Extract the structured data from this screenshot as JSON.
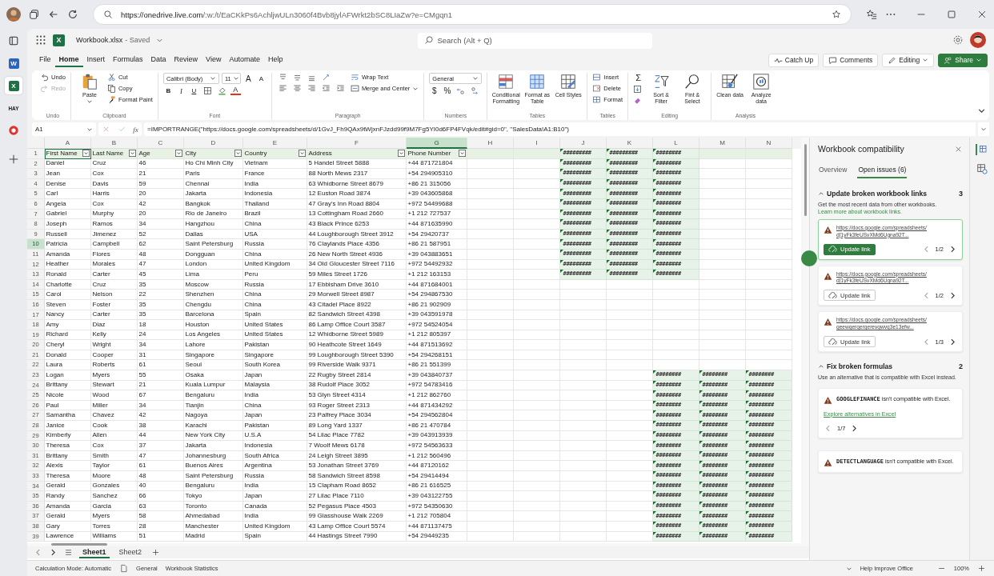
{
  "browser": {
    "url_host": "https://onedrive.live.com",
    "url_path": "/:w:/t/EaCKkPs6AchljwULn3060f4Bvb8jylAFWrkt2bSC8LIaZw?e=CMgqn1"
  },
  "edge_bar": [
    {
      "kind": "tabs",
      "selected": false
    },
    {
      "kind": "word",
      "letter": "W",
      "selected": false
    },
    {
      "kind": "excel",
      "letter": "X",
      "selected": true
    },
    {
      "kind": "text",
      "label": "HAY",
      "selected": false
    },
    {
      "kind": "red",
      "selected": false
    }
  ],
  "header": {
    "logo_letter": "X",
    "file": "Workbook.xlsx",
    "status": "- Saved",
    "search": {
      "placeholder": "Search (Alt + Q)"
    }
  },
  "menu": [
    {
      "label": "File",
      "selected": false
    },
    {
      "label": "Home",
      "selected": true
    },
    {
      "label": "Insert",
      "selected": false
    },
    {
      "label": "Formulas",
      "selected": false
    },
    {
      "label": "Data",
      "selected": false
    },
    {
      "label": "Review",
      "selected": false
    },
    {
      "label": "View",
      "selected": false
    },
    {
      "label": "Automate",
      "selected": false
    },
    {
      "label": "Help",
      "selected": false
    }
  ],
  "actions": {
    "catch_up": "Catch Up",
    "comments": "Comments",
    "editing": "Editing",
    "share": "Share"
  },
  "ribbon": {
    "undo": {
      "label": "Undo",
      "redo": "Redo",
      "redo_disabled": true,
      "group": "Undo"
    },
    "clipboard": {
      "paste": "Paste",
      "cut": "Cut",
      "copy": "Copy",
      "format_paint": "Format Paint",
      "group": "Clipboard"
    },
    "font": {
      "family": "Calibri (Body)",
      "size": "11",
      "grow": "A",
      "shrink": "A",
      "bold": "B",
      "italic": "I",
      "underline": "U",
      "font_color_glyph": "A",
      "group": "Font"
    },
    "paragraph": {
      "wrap": "Wrap Text",
      "merge": "Merge and Center",
      "group": "Paragraph"
    },
    "numbers": {
      "format": "General",
      "currency": "$",
      "percent": "%",
      "group": "Numbers"
    },
    "styles": {
      "conditional": "Conditional Formatting",
      "table": "Format as Table",
      "cell_styles": "Cell Styles",
      "group": "Tables"
    },
    "cells": {
      "insert": "Insert",
      "delete": "Delete",
      "format": "Format",
      "group": "Tables"
    },
    "editing": {
      "sum": "Σ",
      "sort": "Sort & Filter",
      "find": "Fint & Select",
      "group": "Editing"
    },
    "analysis": {
      "clean": "Clean data",
      "analyze": "Analyze data",
      "group": "Analysis"
    }
  },
  "formula_bar": {
    "name_box": "A1",
    "fx": "fx",
    "formula": "=IMPORTRANGE(\"https://docs.google.com/spreadsheets/d/1GvJ_Fh9QAx9tWjxnFJzdd99f9M7Fg5YI0d6FP4FVqk/edit#gid=0\", \"SalesData!A1:B10\")"
  },
  "sheet": {
    "columns": [
      {
        "label": "A",
        "selected": false
      },
      {
        "label": "B",
        "selected": false
      },
      {
        "label": "C",
        "selected": false
      },
      {
        "label": "D",
        "selected": false
      },
      {
        "label": "E",
        "selected": false
      },
      {
        "label": "F",
        "selected": false
      },
      {
        "label": "G",
        "selected": true
      },
      {
        "label": "H",
        "selected": false
      },
      {
        "label": "I",
        "selected": false
      },
      {
        "label": "J",
        "selected": false
      },
      {
        "label": "K",
        "selected": false
      },
      {
        "label": "L",
        "selected": false
      },
      {
        "label": "M",
        "selected": false
      },
      {
        "label": "N",
        "selected": false
      }
    ],
    "rows": [
      {
        "num": "1",
        "kind": "header",
        "selected": false,
        "cells": [
          "First Name",
          "Last Name",
          "Age",
          "City",
          "Country",
          "Address",
          "Phone Number"
        ],
        "overflow": {
          "kind": "upper",
          "values": [
            "#########",
            "#########",
            "########"
          ]
        }
      },
      {
        "num": "2",
        "kind": "data",
        "selected": false,
        "cells": [
          "Daniel",
          "Cruz",
          "46",
          "Ho Chi Minh City",
          "Vietnam",
          "5 Handel Street 5888",
          "+44 871721804"
        ],
        "overflow": {
          "kind": "upper",
          "values": [
            "#########",
            "#########",
            "########"
          ]
        }
      },
      {
        "num": "3",
        "kind": "data",
        "selected": false,
        "cells": [
          "Jean",
          "Cox",
          "21",
          "Paris",
          "France",
          "88 North Mews 2317",
          "+54 294905310"
        ],
        "overflow": {
          "kind": "upper",
          "values": [
            "#########",
            "#########",
            "########"
          ]
        }
      },
      {
        "num": "4",
        "kind": "data",
        "selected": false,
        "cells": [
          "Denise",
          "Davis",
          "59",
          "Chennai",
          "India",
          "63 Whidborne Street 8679",
          "+86 21 315056"
        ],
        "overflow": {
          "kind": "upper",
          "values": [
            "#########",
            "#########",
            "########"
          ]
        }
      },
      {
        "num": "5",
        "kind": "data",
        "selected": false,
        "cells": [
          "Carl",
          "Harris",
          "20",
          "Jakarta",
          "Indonesia",
          "12 Euston Road 3874",
          "+39 043605868"
        ],
        "overflow": {
          "kind": "upper",
          "values": [
            "#########",
            "#########",
            "########"
          ]
        }
      },
      {
        "num": "6",
        "kind": "data",
        "selected": false,
        "cells": [
          "Angela",
          "Cox",
          "42",
          "Bangkok",
          "Thailand",
          "47 Gray's Inn Road 8804",
          "+972 54499688"
        ],
        "overflow": {
          "kind": "upper",
          "values": [
            "#########",
            "#########",
            "########"
          ]
        }
      },
      {
        "num": "7",
        "kind": "data",
        "selected": false,
        "cells": [
          "Gabriel",
          "Murphy",
          "20",
          "Rio de  Janeiro",
          "Brazil",
          "13 Cottingham Road 2660",
          "+1 212 727537"
        ],
        "overflow": {
          "kind": "upper",
          "values": [
            "#########",
            "#########",
            "########"
          ]
        }
      },
      {
        "num": "8",
        "kind": "data",
        "selected": false,
        "cells": [
          "Joseph",
          "Ramos",
          "34",
          "Hangzhou",
          "China",
          "43 Black Prince 6253",
          "+44 871635990"
        ],
        "overflow": {
          "kind": "upper",
          "values": [
            "#########",
            "#########",
            "########"
          ]
        }
      },
      {
        "num": "9",
        "kind": "data",
        "selected": false,
        "cells": [
          "Russell",
          "Jimenez",
          "52",
          "Dallas",
          "USA",
          "44 Loughborough Street 3912",
          "+54 29420737"
        ],
        "overflow": {
          "kind": "upper",
          "values": [
            "#########",
            "#########",
            "########"
          ]
        }
      },
      {
        "num": "10",
        "kind": "data",
        "selected": true,
        "cells": [
          "Patricia",
          "Campbell",
          "62",
          "Saint Petersburg",
          "Russia",
          "76 Claylands Place 4356",
          "+86 21 587951"
        ],
        "overflow": {
          "kind": "upper",
          "values": [
            "#########",
            "#########",
            "########"
          ]
        }
      },
      {
        "num": "11",
        "kind": "data",
        "selected": false,
        "cells": [
          "Amanda",
          "Flores",
          "48",
          "Dongguan",
          "China",
          "26 New North Street 4936",
          "+39 043883651"
        ],
        "overflow": {
          "kind": "upper",
          "values": [
            "#########",
            "#########",
            "########"
          ]
        }
      },
      {
        "num": "12",
        "kind": "data",
        "selected": false,
        "cells": [
          "Heather",
          "Morales",
          "47",
          "London",
          "United Kingdom",
          "34 Old Gloucester Street 7116",
          "+972 54492932"
        ],
        "overflow": {
          "kind": "upper",
          "values": [
            "#########",
            "#########",
            "########"
          ]
        }
      },
      {
        "num": "13",
        "kind": "data",
        "selected": false,
        "cells": [
          "Ronald",
          "Carter",
          "45",
          "Lima",
          "Peru",
          "59 Miles Street 1726",
          "+1 212 163153"
        ],
        "overflow": {
          "kind": "upper",
          "values": [
            "#########",
            "#########",
            "########"
          ]
        }
      },
      {
        "num": "14",
        "kind": "data",
        "selected": false,
        "cells": [
          "Charlotte",
          "Cruz",
          "35",
          "Moscow",
          "Russia",
          "17 Ebbisham Drive 3610",
          "+44 871684001"
        ]
      },
      {
        "num": "15",
        "kind": "data",
        "selected": false,
        "cells": [
          "Carol",
          "Nelson",
          "22",
          "Shenzhen",
          "China",
          "29 Morwell Street 8987",
          "+54 294867530"
        ]
      },
      {
        "num": "16",
        "kind": "data",
        "selected": false,
        "cells": [
          "Steven",
          "Foster",
          "35",
          "Chengdu",
          "China",
          "43 Citadel Place 8922",
          "+86 21 902909"
        ]
      },
      {
        "num": "17",
        "kind": "data",
        "selected": false,
        "cells": [
          "Nancy",
          "Carter",
          "35",
          "Barcelona",
          "Spain",
          "82 Sandwich Street 4398",
          "+39 043591978"
        ]
      },
      {
        "num": "18",
        "kind": "data",
        "selected": false,
        "cells": [
          "Amy",
          "Diaz",
          "18",
          "Houston",
          "United States",
          "86 Lamp Office Court 3587",
          "+972 54524054"
        ]
      },
      {
        "num": "19",
        "kind": "data",
        "selected": false,
        "cells": [
          "Richard",
          "Kelly",
          "24",
          "Los Angeles",
          "United States",
          "12 Whidborne Street 5989",
          "+1 212 805397"
        ]
      },
      {
        "num": "20",
        "kind": "data",
        "selected": false,
        "cells": [
          "Cheryl",
          "Wright",
          "34",
          "Lahore",
          "Pakistan",
          "90 Heathcote Street 1649",
          "+44 871513692"
        ]
      },
      {
        "num": "21",
        "kind": "data",
        "selected": false,
        "cells": [
          "Donald",
          "Cooper",
          "31",
          "Singapore",
          "Singapore",
          "99 Loughborough Street 5390",
          "+54 294268151"
        ]
      },
      {
        "num": "22",
        "kind": "data",
        "selected": false,
        "cells": [
          "Laura",
          "Roberts",
          "61",
          "Seoul",
          "South Korea",
          "99 Riverside Walk 9371",
          "+86 21 551399"
        ]
      },
      {
        "num": "23",
        "kind": "data",
        "selected": false,
        "cells": [
          "Logan",
          "Myers",
          "55",
          "Osaka",
          "Japan",
          "22 Rugby Street 2814",
          "+39 043840737"
        ],
        "overflow": {
          "kind": "lower",
          "values": [
            "########",
            "########",
            "########"
          ]
        }
      },
      {
        "num": "24",
        "kind": "data",
        "selected": false,
        "cells": [
          "Brittany",
          "Stewart",
          "21",
          "Kuala Lumpur",
          "Malaysia",
          "38 Rudolf Place 3052",
          "+972 54783416"
        ],
        "overflow": {
          "kind": "lower",
          "values": [
            "########",
            "########",
            "########"
          ]
        }
      },
      {
        "num": "25",
        "kind": "data",
        "selected": false,
        "cells": [
          "Nicole",
          "Wood",
          "67",
          "Bengaluru",
          "India",
          "53 Glyn Street 4314",
          "+1 212 862760"
        ],
        "overflow": {
          "kind": "lower",
          "values": [
            "########",
            "########",
            "########"
          ]
        }
      },
      {
        "num": "26",
        "kind": "data",
        "selected": false,
        "cells": [
          "Paul",
          "Miller",
          "34",
          "Tianjin",
          "China",
          "93 Roger Street 2313",
          "+44 871434292"
        ],
        "overflow": {
          "kind": "lower",
          "values": [
            "########",
            "########",
            "########"
          ]
        }
      },
      {
        "num": "27",
        "kind": "data",
        "selected": false,
        "cells": [
          "Samantha",
          "Chavez",
          "42",
          "Nagoya",
          "Japan",
          "23 Palfrey Place 3034",
          "+54 294562804"
        ],
        "overflow": {
          "kind": "lower",
          "values": [
            "########",
            "########",
            "########"
          ]
        }
      },
      {
        "num": "28",
        "kind": "data",
        "selected": false,
        "cells": [
          "Janice",
          "Cook",
          "38",
          "Karachi",
          "Pakistan",
          "89 Long Yard 1337",
          "+86 21 470784"
        ],
        "overflow": {
          "kind": "lower",
          "values": [
            "########",
            "########",
            "########"
          ]
        }
      },
      {
        "num": "29",
        "kind": "data",
        "selected": false,
        "cells": [
          "Kimberly",
          "Allen",
          "44",
          "New  York City",
          "U.S.A",
          "54 Lilac Place 7782",
          "+39 043913939"
        ],
        "overflow": {
          "kind": "lower",
          "values": [
            "########",
            "########",
            "########"
          ]
        }
      },
      {
        "num": "30",
        "kind": "data",
        "selected": false,
        "cells": [
          "Theresa",
          "Cox",
          "37",
          "Jakarta",
          "Indonesia",
          "7 Woolf Mews 6178",
          "+972 54563633"
        ],
        "overflow": {
          "kind": "lower",
          "values": [
            "########",
            "########",
            "########"
          ]
        }
      },
      {
        "num": "31",
        "kind": "data",
        "selected": false,
        "cells": [
          "Brittany",
          "Smith",
          "47",
          "Johannesburg",
          "South Africa",
          "24 Leigh Street 3895",
          "+1 212 560496"
        ],
        "overflow": {
          "kind": "lower",
          "values": [
            "########",
            "########",
            "########"
          ]
        }
      },
      {
        "num": "32",
        "kind": "data",
        "selected": false,
        "cells": [
          "Alexis",
          "Taylor",
          "61",
          "Buenos Aires",
          "Argentina",
          "53 Jonathan Street 3769",
          "+44 87120162"
        ],
        "overflow": {
          "kind": "lower",
          "values": [
            "########",
            "########",
            "########"
          ]
        }
      },
      {
        "num": "33",
        "kind": "data",
        "selected": false,
        "cells": [
          "Theresa",
          "Moore",
          "48",
          "Saint Petersburg",
          "Russia",
          "58 Sandwich Street 8598",
          "+54 29414494"
        ],
        "overflow": {
          "kind": "lower",
          "values": [
            "########",
            "########",
            "########"
          ]
        }
      },
      {
        "num": "34",
        "kind": "data",
        "selected": false,
        "cells": [
          "Gerald",
          "Gonzales",
          "40",
          "Bengaluru",
          "India",
          "15 Clapham Road 8652",
          "+86 21 616525"
        ],
        "overflow": {
          "kind": "lower",
          "values": [
            "########",
            "########",
            "########"
          ]
        }
      },
      {
        "num": "35",
        "kind": "data",
        "selected": false,
        "cells": [
          "Randy",
          "Sanchez",
          "66",
          "Tokyo",
          "Japan",
          "27 Lilac Place 7110",
          "+39 043122755"
        ],
        "overflow": {
          "kind": "lower",
          "values": [
            "########",
            "########",
            "########"
          ]
        }
      },
      {
        "num": "36",
        "kind": "data",
        "selected": false,
        "cells": [
          "Amanda",
          "Garcia",
          "63",
          "Toronto",
          "Canada",
          "52 Pegasus Place 4503",
          "+972 54350630"
        ],
        "overflow": {
          "kind": "lower",
          "values": [
            "########",
            "########",
            "########"
          ]
        }
      },
      {
        "num": "37",
        "kind": "data",
        "selected": false,
        "cells": [
          "Gerald",
          "Myers",
          "58",
          "Ahmedabad",
          "India",
          "99 Glasshouse Walk 2269",
          "+1 212 705804"
        ],
        "overflow": {
          "kind": "lower",
          "values": [
            "########",
            "########",
            "########"
          ]
        }
      },
      {
        "num": "38",
        "kind": "data",
        "selected": false,
        "cells": [
          "Gary",
          "Torres",
          "28",
          "Manchester",
          "United Kingdom",
          "43 Lamp Office Court 5574",
          "+44 871137475"
        ],
        "overflow": {
          "kind": "lower",
          "values": [
            "########",
            "########",
            "########"
          ]
        }
      },
      {
        "num": "39",
        "kind": "data",
        "selected": false,
        "cells": [
          "Lawrence",
          "Williams",
          "51",
          "Madrid",
          "Spain",
          "44 Hastings Street 7990",
          "+54 29449235"
        ],
        "overflow": {
          "kind": "lower",
          "values": [
            "########",
            "########",
            "########"
          ]
        }
      }
    ],
    "tabs": [
      {
        "label": "Sheet1",
        "selected": true
      },
      {
        "label": "Sheet2",
        "selected": false
      }
    ]
  },
  "panel": {
    "title": "Workbook compatibility",
    "tabs": [
      {
        "label": "Overview",
        "selected": false
      },
      {
        "label": "Open issues (6)",
        "selected": true
      }
    ],
    "links_section": {
      "title": "Update broken workbook links",
      "count": "3",
      "expanded": true,
      "description": "Get the most recent data from other workbooks.",
      "learn_more": "Learn more about workbook links.",
      "cards": [
        {
          "lines": [
            "https://docs.google.com/spreadsheets/",
            "d[1yFk3feUSvXMd6Ugna92T..."
          ],
          "button": "Update link",
          "selected": true,
          "pager": "1/2"
        },
        {
          "lines": [
            "https://docs.google.com/spreadsheets/",
            "d[1yFk3feUSvXMd6Ugna92T..."
          ],
          "button": "Update link",
          "selected": false,
          "pager": "1/2"
        },
        {
          "lines": [
            "https://docs.google.com/spreadsheets/",
            "qeewqerqerqerevqwvq3e13efw..."
          ],
          "button": "Update link",
          "selected": false,
          "pager": "1/3"
        }
      ]
    },
    "formulas_section": {
      "title": "Fix broken formulas",
      "count": "2",
      "expanded": true,
      "description": "Use an alternative that is compatible with Excel instead.",
      "cards": [
        {
          "text": "**GOOGLEFINANCE** isn't compatible with Excel.",
          "link": "Explore alternatives in Excel",
          "pager": "1/7"
        },
        {
          "text": "**DETECTLANGUAGE** isn't compatible with Excel."
        }
      ]
    }
  },
  "status_bar": {
    "calc": "Calculation Mode: Automatic",
    "format": "General",
    "stats": "Workbook Statistics",
    "help": "Help Improve Office",
    "zoom": "100%"
  }
}
